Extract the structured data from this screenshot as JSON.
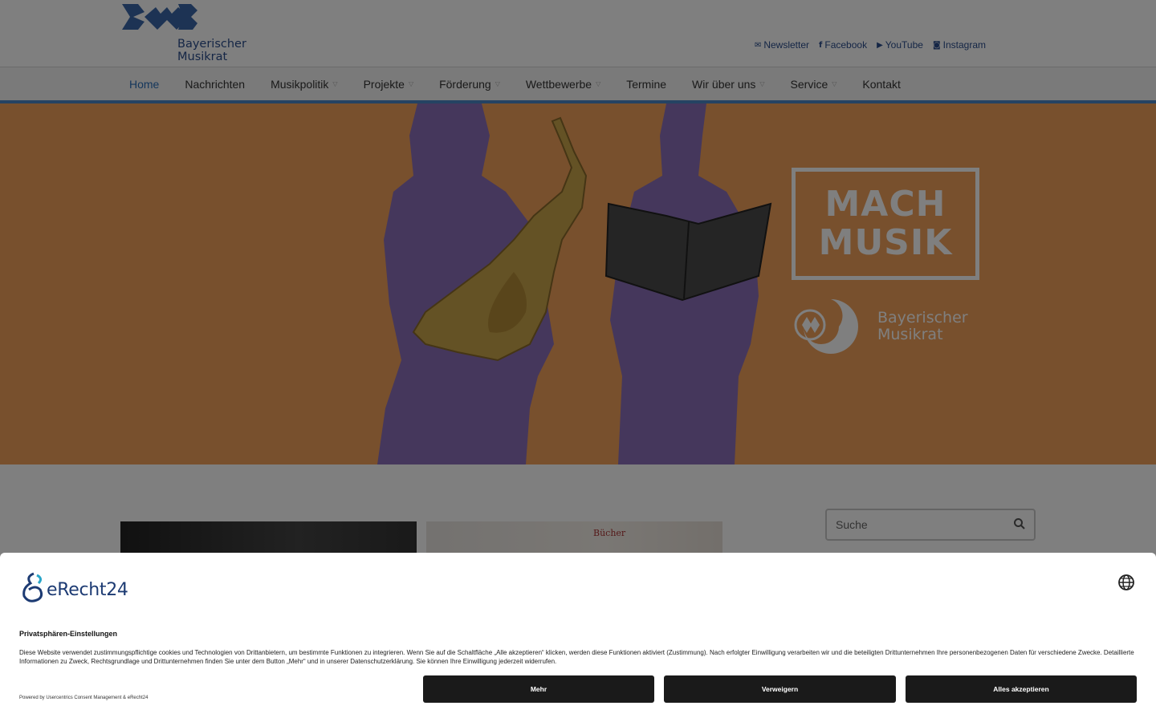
{
  "header": {
    "logo_text_line1": "Bayerischer",
    "logo_text_line2": "Musikrat",
    "social": [
      {
        "label": "Newsletter",
        "icon": "envelope-icon"
      },
      {
        "label": "Facebook",
        "icon": "facebook-icon"
      },
      {
        "label": "YouTube",
        "icon": "youtube-icon"
      },
      {
        "label": "Instagram",
        "icon": "instagram-icon"
      }
    ]
  },
  "nav": {
    "items": [
      {
        "label": "Home",
        "active": true,
        "dropdown": false
      },
      {
        "label": "Nachrichten",
        "dropdown": false
      },
      {
        "label": "Musikpolitik",
        "dropdown": true
      },
      {
        "label": "Projekte",
        "dropdown": true
      },
      {
        "label": "Förderung",
        "dropdown": true
      },
      {
        "label": "Wettbewerbe",
        "dropdown": true
      },
      {
        "label": "Termine",
        "dropdown": false
      },
      {
        "label": "Wir über uns",
        "dropdown": true
      },
      {
        "label": "Service",
        "dropdown": true
      },
      {
        "label": "Kontakt",
        "dropdown": false
      }
    ]
  },
  "hero": {
    "box_line1": "MACH",
    "box_line2": "MUSIK",
    "brand_line1": "Bayerischer",
    "brand_line2": "Musikrat",
    "colors": {
      "background": "#f0a05a",
      "silhouette": "#8a6fb8"
    }
  },
  "content": {
    "card2_label": "Bücher",
    "search_placeholder": "Suche"
  },
  "consent": {
    "brand": "eRecht24",
    "title": "Privatsphären-Einstellungen",
    "description": "Diese Website verwendet zustimmungspflichtige cookies und Technologien von Drittanbietern, um bestimmte Funktionen zu integrieren. Wenn Sie auf die Schaltfläche „Alle akzeptieren“ klicken, werden diese Funktionen aktiviert (Zustimmung). Nach erfolgter Einwilligung verarbeiten wir und die beteiligten Drittunternehmen Ihre personenbezogenen Daten für verschiedene Zwecke. Detaillierte Informationen zu Zweck, Rechtsgrundlage und Drittunternehmen finden Sie unter dem Button „Mehr“ und in unserer Datenschutzerklärung. Sie können Ihre Einwilligung jederzeit widerrufen.",
    "powered": "Powered by Usercentrics Consent Management & eRecht24",
    "buttons": {
      "more": "Mehr",
      "deny": "Verweigern",
      "accept_all": "Alles akzeptieren"
    }
  },
  "colors": {
    "accent": "#2a6fb8",
    "nav_bar": "#4a86c6",
    "brand_blue": "#2a4d8c",
    "button": "#1a1a1a"
  }
}
